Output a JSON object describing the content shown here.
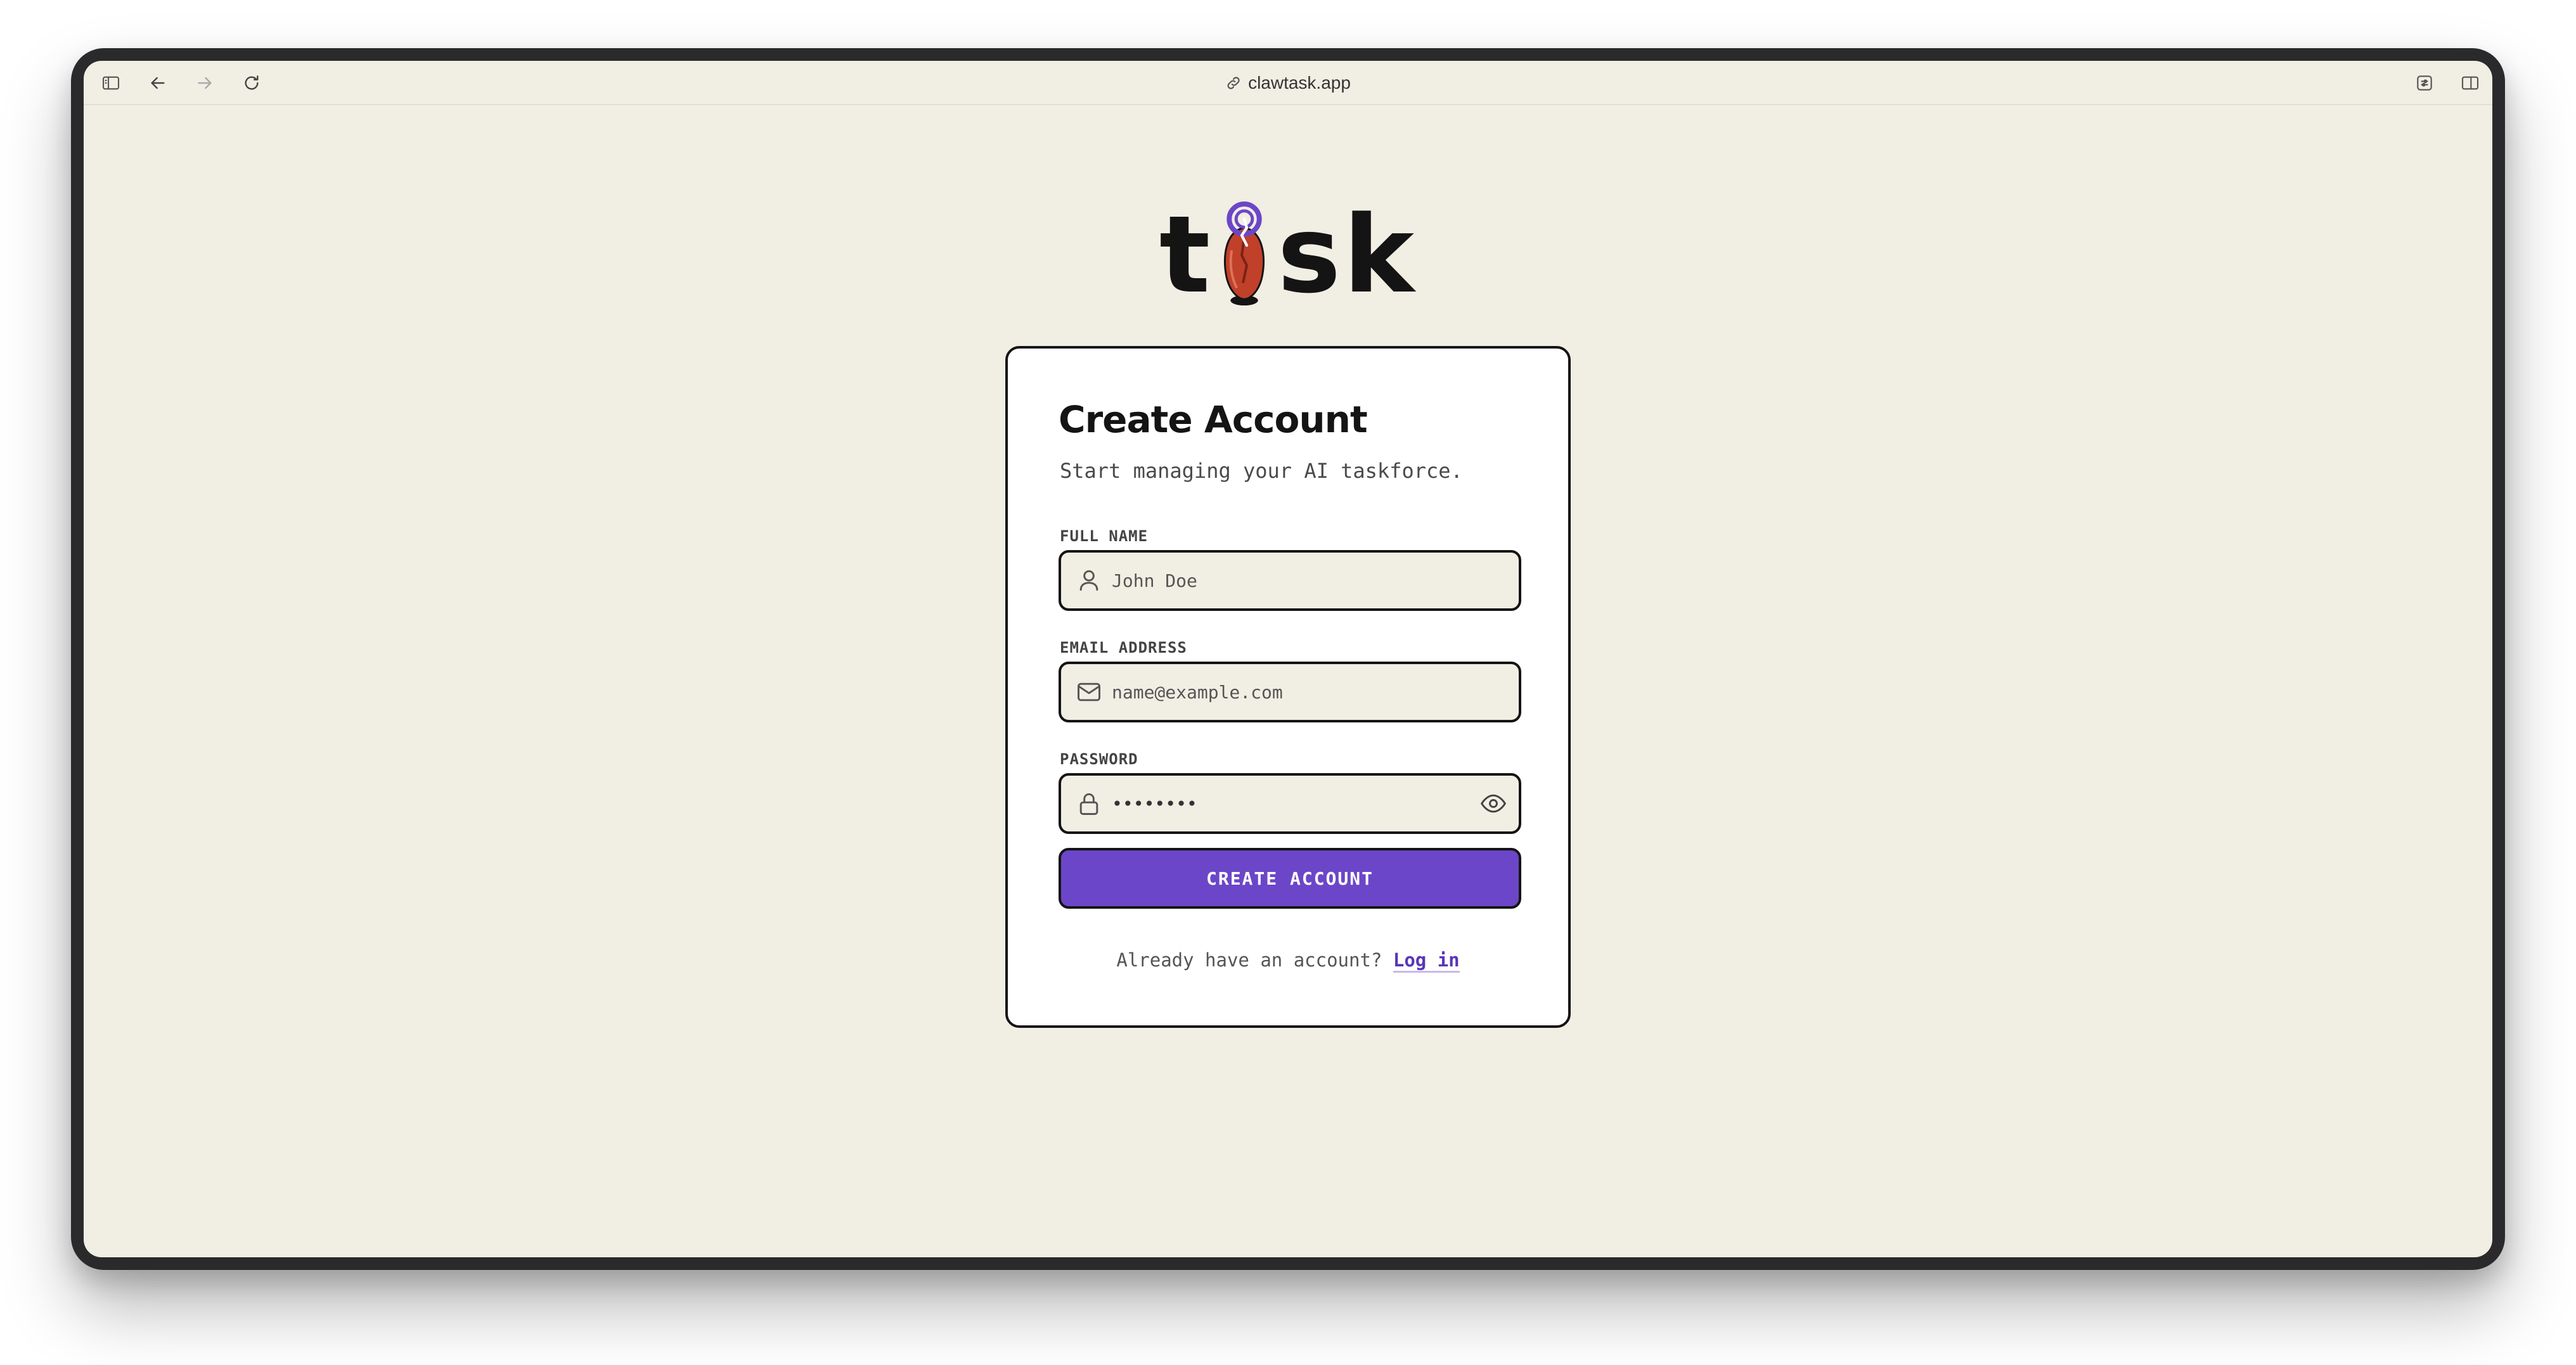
{
  "browser": {
    "url": "clawtask.app",
    "icons": {
      "sidebar": "sidebar-icon",
      "back": "arrow-left-icon",
      "forward": "arrow-right-icon",
      "reload": "reload-icon",
      "link": "link-icon",
      "extension": "extension-icon",
      "split_view": "split-view-icon"
    }
  },
  "logo": {
    "letter_left": "t",
    "letters_right": "sk"
  },
  "form": {
    "title": "Create Account",
    "subtitle": "Start managing your AI taskforce.",
    "full_name": {
      "label": "FULL NAME",
      "placeholder": "John Doe",
      "value": ""
    },
    "email": {
      "label": "EMAIL ADDRESS",
      "placeholder": "name@example.com",
      "value": ""
    },
    "password": {
      "label": "PASSWORD",
      "value": "••••••••"
    },
    "submit_label": "CREATE ACCOUNT",
    "footer_text": "Already have an account?",
    "login_link": "Log in"
  },
  "colors": {
    "background": "#f1eee3",
    "accent": "#6c46c8",
    "border": "#141414",
    "mascot": "#c0402a"
  }
}
